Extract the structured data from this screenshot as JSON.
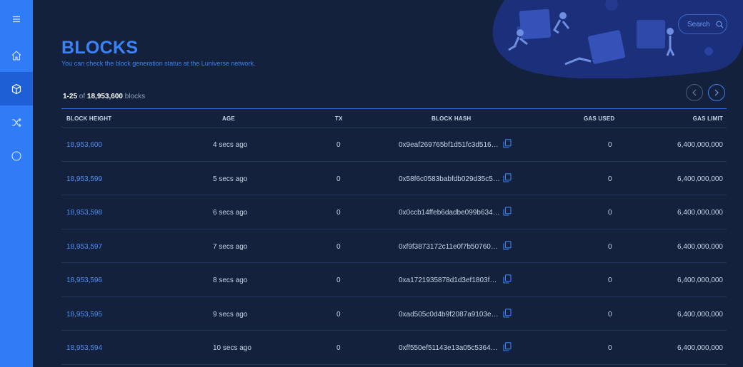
{
  "sidebar": {
    "items": [
      {
        "name": "menu",
        "icon": "hamburger-menu-icon"
      },
      {
        "name": "home",
        "icon": "home-icon"
      },
      {
        "name": "blocks",
        "icon": "cube-icon",
        "active": true
      },
      {
        "name": "transactions",
        "icon": "shuffle-icon"
      },
      {
        "name": "circle",
        "icon": "circle-icon"
      }
    ]
  },
  "header": {
    "search_label": "Search",
    "title": "BLOCKS",
    "subtitle": "You can check the block generation status at the Luniverse network."
  },
  "summary": {
    "range": "1-25",
    "of": "of",
    "total": "18,953,600",
    "unit": "blocks"
  },
  "table": {
    "columns": [
      "BLOCK HEIGHT",
      "AGE",
      "TX",
      "BLOCK HASH",
      "GAS USED",
      "GAS LIMIT"
    ],
    "rows": [
      {
        "height": "18,953,600",
        "age": "4 secs ago",
        "tx": "0",
        "hash": "0x9eaf269765bf1d51fc3d5166...",
        "gas_used": "0",
        "gas_limit": "6,400,000,000"
      },
      {
        "height": "18,953,599",
        "age": "5 secs ago",
        "tx": "0",
        "hash": "0x58f6c0583babfdb029d35c56...",
        "gas_used": "0",
        "gas_limit": "6,400,000,000"
      },
      {
        "height": "18,953,598",
        "age": "6 secs ago",
        "tx": "0",
        "hash": "0x0ccb14ffeb6dadbe099b634b...",
        "gas_used": "0",
        "gas_limit": "6,400,000,000"
      },
      {
        "height": "18,953,597",
        "age": "7 secs ago",
        "tx": "0",
        "hash": "0xf9f3873172c11e0f7b507607...",
        "gas_used": "0",
        "gas_limit": "6,400,000,000"
      },
      {
        "height": "18,953,596",
        "age": "8 secs ago",
        "tx": "0",
        "hash": "0xa1721935878d1d3ef1803f83...",
        "gas_used": "0",
        "gas_limit": "6,400,000,000"
      },
      {
        "height": "18,953,595",
        "age": "9 secs ago",
        "tx": "0",
        "hash": "0xad505c0d4b9f2087a9103ede...",
        "gas_used": "0",
        "gas_limit": "6,400,000,000"
      },
      {
        "height": "18,953,594",
        "age": "10 secs ago",
        "tx": "0",
        "hash": "0xff550ef51143e13a05c53648...",
        "gas_used": "0",
        "gas_limit": "6,400,000,000"
      }
    ]
  },
  "colors": {
    "background": "#13213d",
    "sidebar": "#2f7cf6",
    "accent": "#3b82f6"
  }
}
